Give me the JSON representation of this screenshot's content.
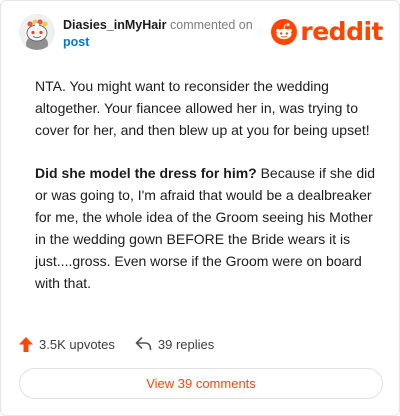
{
  "comment": {
    "username": "Diasies_inMyHair",
    "action_text": "commented on",
    "target_link": "post",
    "brand": "reddit",
    "paragraphs": [
      {
        "bold": "",
        "text": "NTA. You might want to reconsider the wedding altogether. Your fiancee allowed her in, was trying to cover for her, and then blew up at you for being upset!"
      },
      {
        "bold": "Did she model the dress for him?",
        "text": " Because if she did or was going to, I'm afraid that would be a dealbreaker for me, the whole idea of the Groom seeing his Mother in the wedding gown BEFORE the Bride wears it is just....gross. Even worse if the Groom were on board with that."
      }
    ]
  },
  "footer": {
    "upvotes": "3.5K upvotes",
    "replies": "39 replies",
    "view_button": "View 39 comments"
  },
  "colors": {
    "brand": "#ff4500",
    "link": "#0079d3"
  },
  "icons": [
    "avatar-snoo",
    "reddit-logo-icon",
    "upvote-arrow-icon",
    "reply-icon"
  ]
}
